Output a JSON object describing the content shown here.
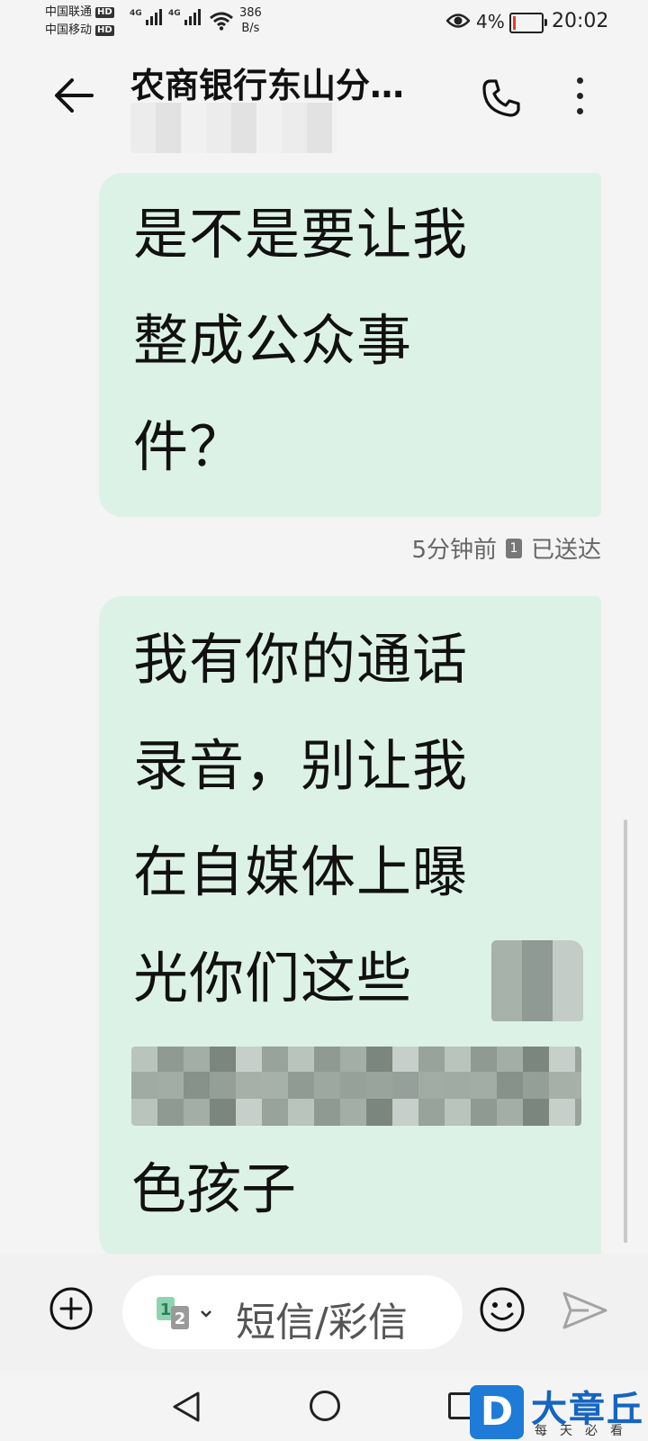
{
  "status_bar": {
    "carrier1": "中国联通",
    "carrier2": "中国移动",
    "hd": "HD",
    "net1": "4G",
    "net2": "4G",
    "speed_value": "386",
    "speed_unit": "B/s",
    "battery_percent": "4%",
    "time": "20:02"
  },
  "header": {
    "title": "农商银行东山分…",
    "back_icon": "arrow-left-icon",
    "call_icon": "phone-icon",
    "menu_icon": "more-vertical-icon"
  },
  "messages": [
    {
      "lines": [
        "是不是要让我",
        "整成公众事",
        "件？"
      ],
      "meta_time": "5分钟前",
      "meta_sim": "1",
      "meta_status": "已送达"
    },
    {
      "lines": [
        "我有你的通话",
        "录音，别让我",
        "在自媒体上曝",
        "光你们这些"
      ],
      "last_line": "色孩子"
    }
  ],
  "composer": {
    "placeholder": "短信/彩信",
    "sim_primary": "1",
    "sim_secondary": "2"
  },
  "watermark": {
    "logo_letter": "D",
    "name": "大章丘",
    "slogan": "每天必看"
  },
  "colors": {
    "bubble": "#ddf2e6",
    "background": "#f4f4f4",
    "watermark_blue": "#1e7bd8"
  }
}
